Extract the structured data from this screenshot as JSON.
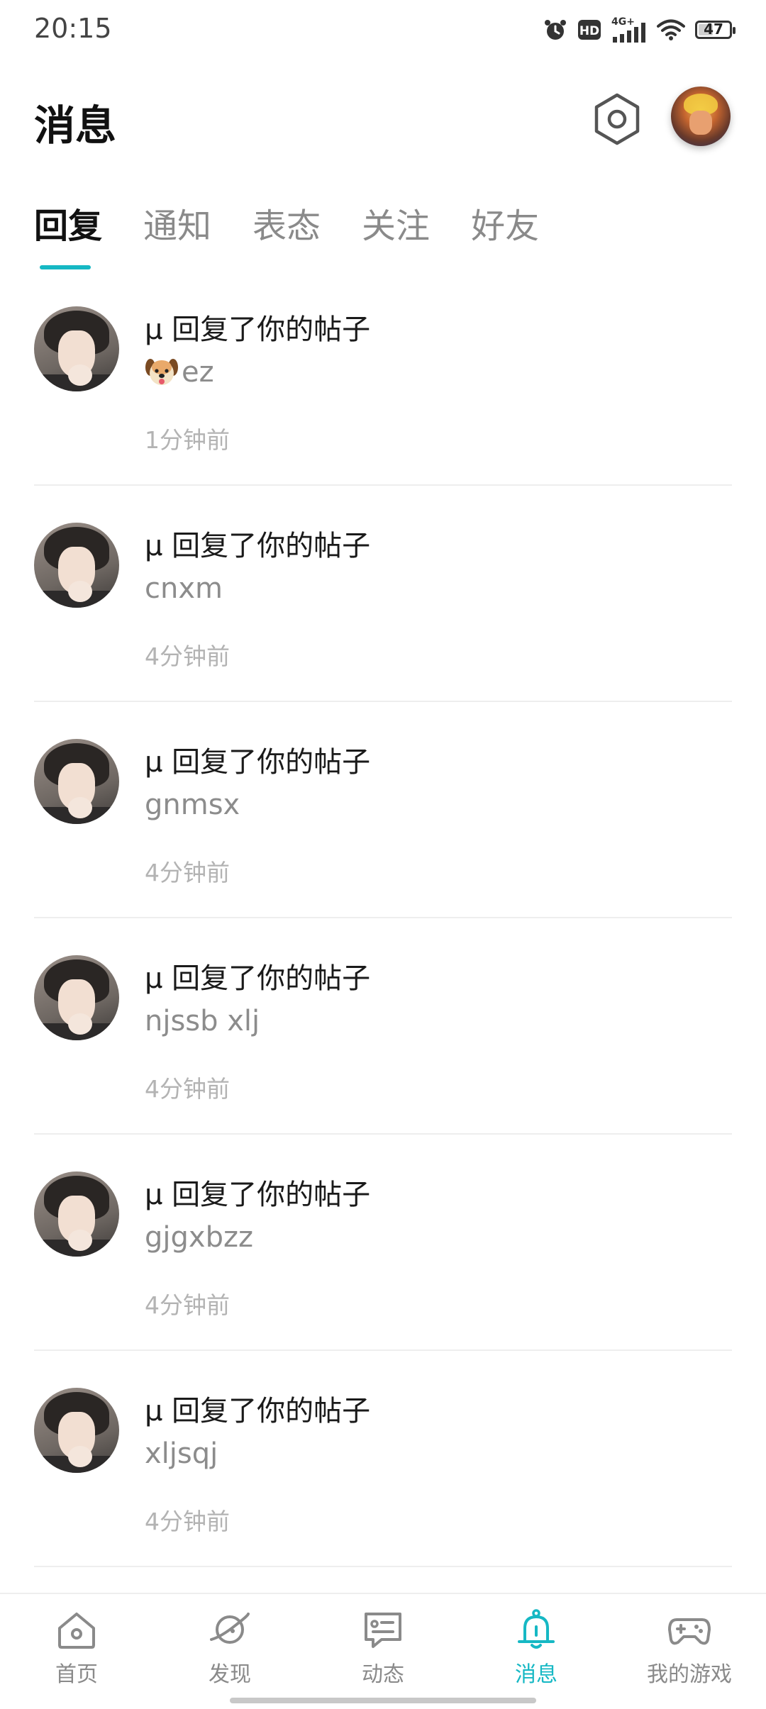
{
  "status_bar": {
    "time": "20:15",
    "battery": "47",
    "battery_level": 0.47,
    "network": "4G+",
    "hd_label": "HD",
    "icons": [
      "alarm-icon",
      "hd-icon",
      "cellular-signal-icon",
      "wifi-icon",
      "battery-icon"
    ]
  },
  "header": {
    "title": "消息",
    "settings_icon": "hexagon-settings-icon",
    "avatar_icon": "profile-avatar"
  },
  "tabs": [
    {
      "label": "回复",
      "active": true
    },
    {
      "label": "通知",
      "active": false
    },
    {
      "label": "表态",
      "active": false
    },
    {
      "label": "关注",
      "active": false
    },
    {
      "label": "好友",
      "active": false
    }
  ],
  "messages": [
    {
      "title": "μ 回复了你的帖子",
      "content": "ez",
      "time": "1分钟前",
      "emoji": "dog-face-icon"
    },
    {
      "title": "μ 回复了你的帖子",
      "content": "cnxm",
      "time": "4分钟前"
    },
    {
      "title": "μ 回复了你的帖子",
      "content": "gnmsx",
      "time": "4分钟前"
    },
    {
      "title": "μ 回复了你的帖子",
      "content": "njssb xlj",
      "time": "4分钟前"
    },
    {
      "title": "μ 回复了你的帖子",
      "content": "gjgxbzz",
      "time": "4分钟前"
    },
    {
      "title": "μ 回复了你的帖子",
      "content": "xljsqj",
      "time": "4分钟前"
    }
  ],
  "bottom_nav": [
    {
      "label": "首页",
      "icon": "home-icon",
      "active": false
    },
    {
      "label": "发现",
      "icon": "planet-icon",
      "active": false
    },
    {
      "label": "动态",
      "icon": "chat-bubble-icon",
      "active": false
    },
    {
      "label": "消息",
      "icon": "bell-icon",
      "active": true
    },
    {
      "label": "我的游戏",
      "icon": "gamepad-icon",
      "active": false
    }
  ],
  "colors": {
    "accent": "#16b8c4",
    "text_primary": "#1a1a1a",
    "text_secondary": "#8c8c8c",
    "text_tertiary": "#b3b3b3",
    "divider": "#eeeeee"
  }
}
